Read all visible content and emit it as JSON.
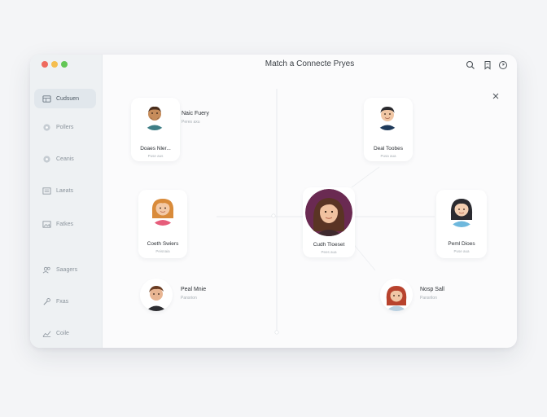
{
  "window": {
    "title": "Match a Connecte Pryes",
    "traffic_colors": [
      "#ee6a5e",
      "#f5be4f",
      "#62c655"
    ]
  },
  "sidebar": {
    "items": [
      {
        "label": "Cudsuen",
        "icon": "grid-icon",
        "active": true
      },
      {
        "label": "Pollers",
        "icon": "circle-icon",
        "active": false
      },
      {
        "label": "Ceanis",
        "icon": "circle-icon",
        "active": false
      },
      {
        "label": "Laeats",
        "icon": "list-icon",
        "active": false
      },
      {
        "label": "Fatkes",
        "icon": "image-icon",
        "active": false
      },
      {
        "label": "Saagers",
        "icon": "people-icon",
        "active": false
      },
      {
        "label": "Fxas",
        "icon": "wrench-icon",
        "active": false
      },
      {
        "label": "Coile",
        "icon": "chart-icon",
        "active": false
      }
    ]
  },
  "toolbar": {
    "icons": [
      "search-icon",
      "bookmark-icon",
      "clock-icon"
    ]
  },
  "people": {
    "top_left": {
      "name": "Doaes Nler...",
      "sub": "Puse aus",
      "side_name": "Naic Fuery",
      "side_sub": "Peres axu"
    },
    "mid_left": {
      "name": "Coeth Swiers",
      "sub": "Peisnaia"
    },
    "bottom_left": {
      "name": "Peal Mnie",
      "sub": "Pansrion"
    },
    "top_right": {
      "name": "Deal Toobes",
      "sub": "Pusa aua"
    },
    "center": {
      "name": "Cudh Tloeset",
      "sub": "Pees aua"
    },
    "mid_right": {
      "name": "Peml Dioes",
      "sub": "Puse aua"
    },
    "bottom_right": {
      "name": "Nosp Sall",
      "sub": "Pansrilon"
    }
  }
}
